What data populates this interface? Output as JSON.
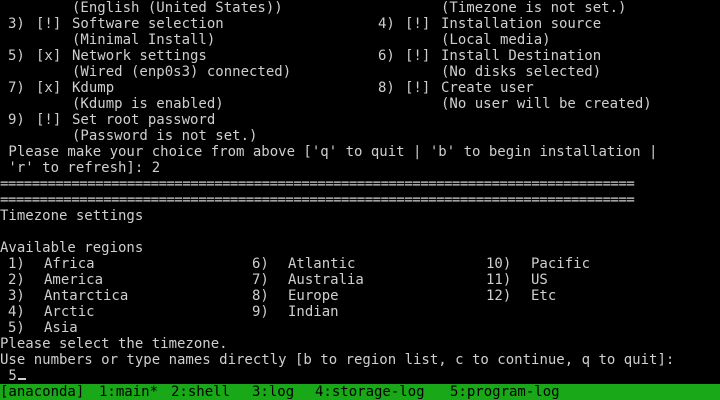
{
  "colors": {
    "background": "#000000",
    "text": "#cfcfcf",
    "statusbar_bg": "#18a818",
    "statusbar_text": "#000000"
  },
  "hub": {
    "lang_status": "(English (United States))",
    "tz_status": "(Timezone is not set.)",
    "spokes": [
      {
        "num": "3)",
        "mark": "[!]",
        "title": "Software selection",
        "status": "(Minimal Install)"
      },
      {
        "num": "4)",
        "mark": "[!]",
        "title": "Installation source",
        "status": "(Local media)"
      },
      {
        "num": "5)",
        "mark": "[x]",
        "title": "Network settings",
        "status": "(Wired (enp0s3) connected)"
      },
      {
        "num": "6)",
        "mark": "[!]",
        "title": "Install Destination",
        "status": "(No disks selected)"
      },
      {
        "num": "7)",
        "mark": "[x]",
        "title": "Kdump",
        "status": "(Kdump is enabled)"
      },
      {
        "num": "8)",
        "mark": "[!]",
        "title": "Create user",
        "status": "(No user will be created)"
      },
      {
        "num": "9)",
        "mark": "[!]",
        "title": "Set root password",
        "status": "(Password is not set.)"
      }
    ],
    "prompt_line1": " Please make your choice from above ['q' to quit | 'b' to begin installation |",
    "prompt_line2": " 'r' to refresh]: 2"
  },
  "separator": "================================================================================",
  "timezone": {
    "heading": "Timezone settings",
    "regions_label": "Available regions",
    "regions": [
      {
        "num": "1)",
        "name": "Africa"
      },
      {
        "num": "2)",
        "name": "America"
      },
      {
        "num": "3)",
        "name": "Antarctica"
      },
      {
        "num": "4)",
        "name": "Arctic"
      },
      {
        "num": "5)",
        "name": "Asia"
      },
      {
        "num": "6)",
        "name": "Atlantic"
      },
      {
        "num": "7)",
        "name": "Australia"
      },
      {
        "num": "8)",
        "name": "Europe"
      },
      {
        "num": "9)",
        "name": "Indian"
      },
      {
        "num": "10)",
        "name": "Pacific"
      },
      {
        "num": "11)",
        "name": "US"
      },
      {
        "num": "12)",
        "name": "Etc"
      }
    ],
    "select_prompt": "Please select the timezone.",
    "help_line": "Use numbers or type names directly [b to region list, c to continue, q to quit]:",
    "input_value": " 5"
  },
  "statusbar": {
    "items": [
      "[anaconda]",
      "1:main*",
      "2:shell",
      "3:log",
      "4:storage-log",
      "5:program-log"
    ]
  }
}
